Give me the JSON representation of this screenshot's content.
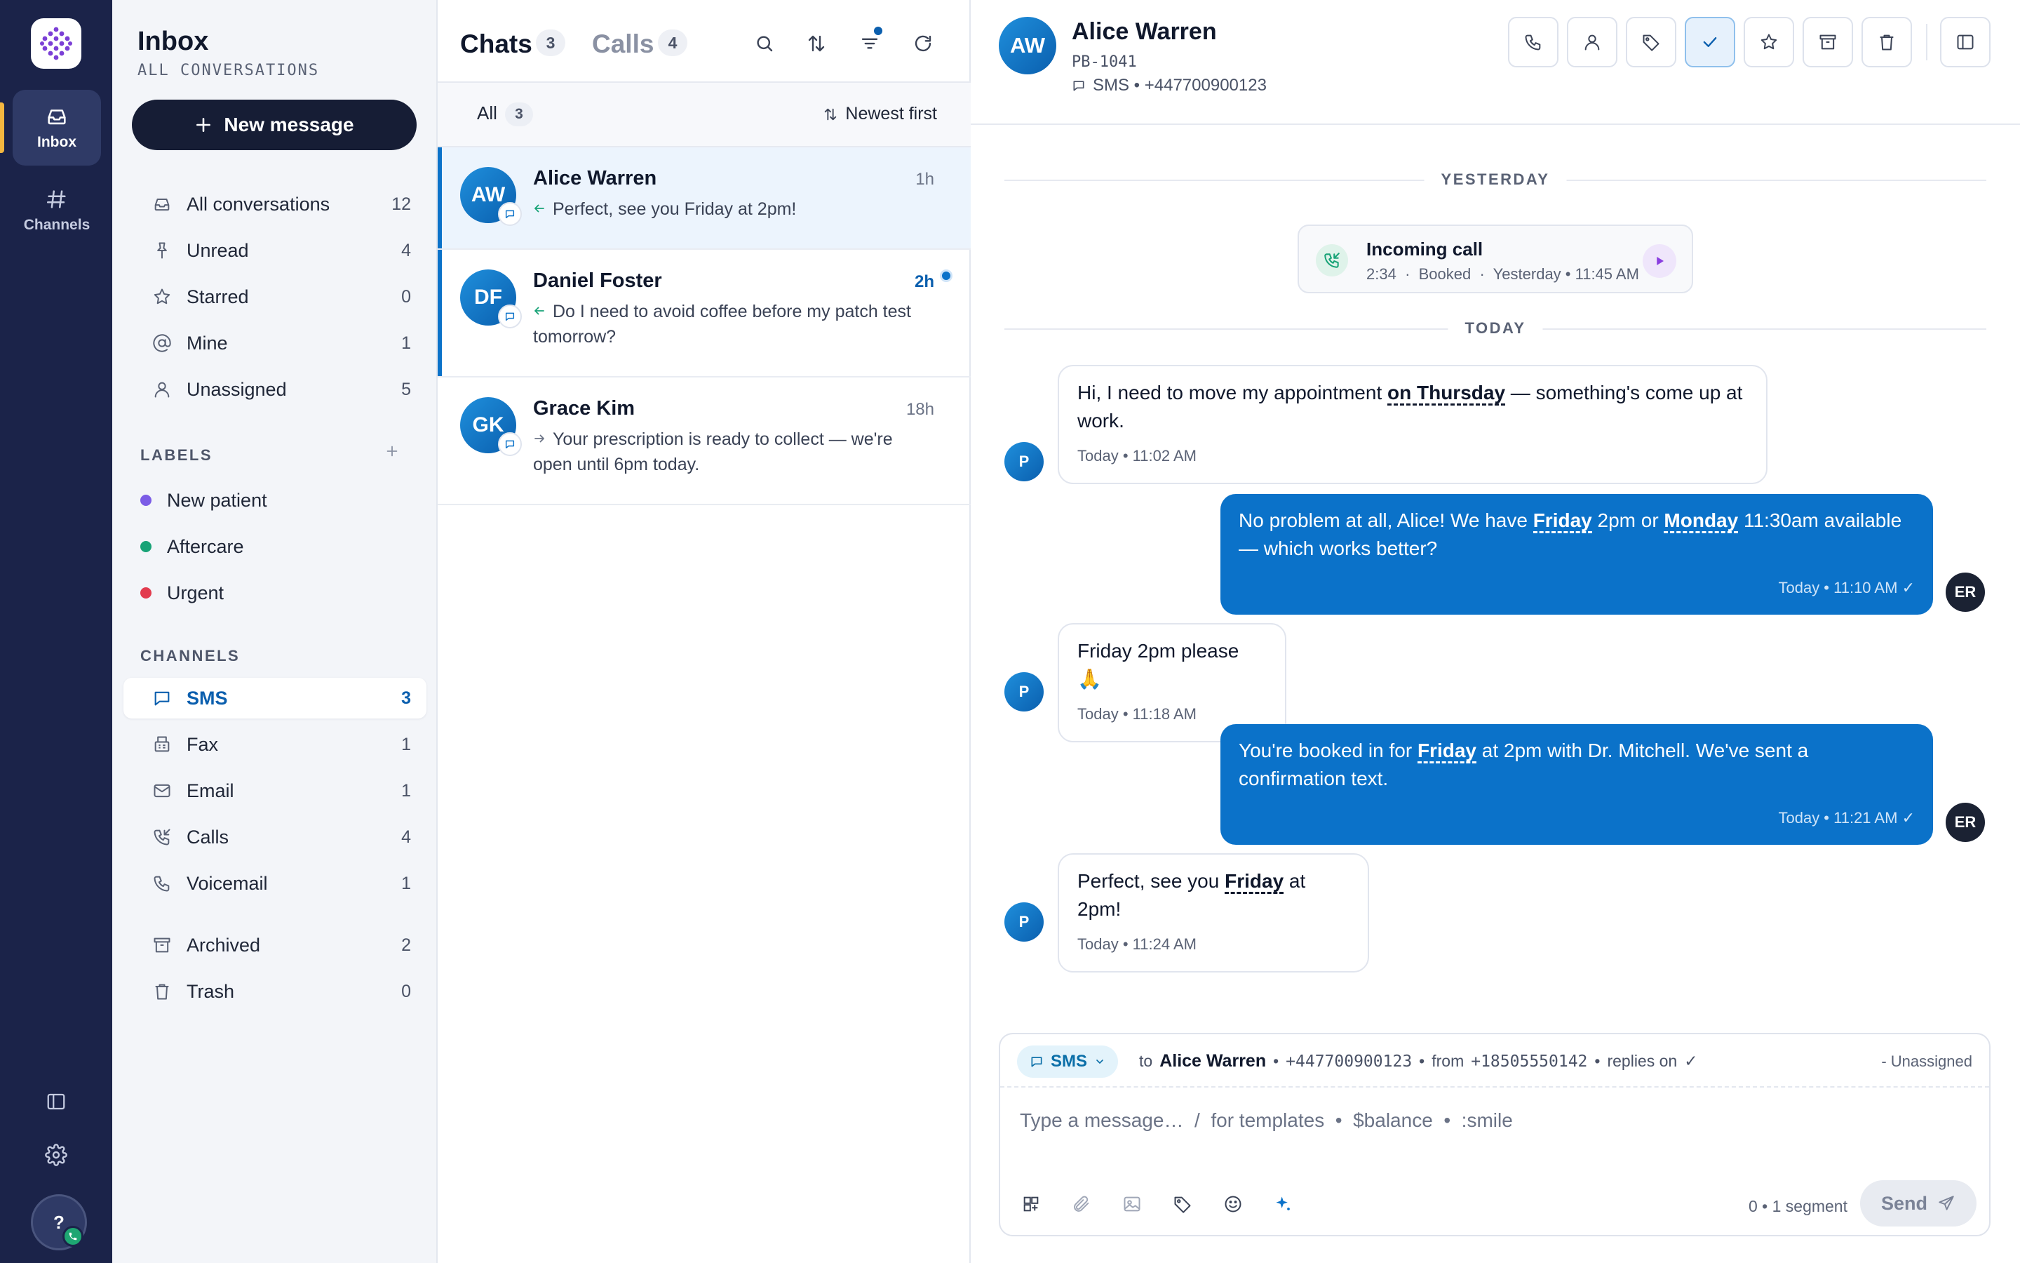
{
  "rail": {
    "items": [
      {
        "label": "Inbox",
        "icon": "inbox-icon"
      },
      {
        "label": "Channels",
        "icon": "hash-icon"
      }
    ],
    "help_label": "?",
    "accent": "#f4b740"
  },
  "sidebar": {
    "title": "Inbox",
    "subtitle": "ALL CONVERSATIONS",
    "new_message_label": "New message",
    "views": [
      {
        "label": "All conversations",
        "count": "12",
        "icon": "inbox-icon"
      },
      {
        "label": "Unread",
        "count": "4",
        "icon": "pin-icon"
      },
      {
        "label": "Starred",
        "count": "0",
        "icon": "star-icon"
      },
      {
        "label": "Mine",
        "count": "1",
        "icon": "at-icon"
      },
      {
        "label": "Unassigned",
        "count": "5",
        "icon": "user-icon"
      }
    ],
    "labels_heading": "LABELS",
    "labels": [
      {
        "label": "New patient",
        "color": "#7b5ce6"
      },
      {
        "label": "Aftercare",
        "color": "#18a377"
      },
      {
        "label": "Urgent",
        "color": "#e23b4e"
      }
    ],
    "channels_heading": "CHANNELS",
    "channels": [
      {
        "label": "SMS",
        "count": "3",
        "icon": "message-icon"
      },
      {
        "label": "Fax",
        "count": "1",
        "icon": "fax-icon"
      },
      {
        "label": "Email",
        "count": "1",
        "icon": "mail-icon"
      },
      {
        "label": "Calls",
        "count": "4",
        "icon": "phone-incoming-icon"
      },
      {
        "label": "Voicemail",
        "count": "1",
        "icon": "phone-icon"
      }
    ],
    "other": [
      {
        "label": "Archived",
        "count": "2",
        "icon": "archive-icon"
      },
      {
        "label": "Trash",
        "count": "0",
        "icon": "trash-icon"
      }
    ]
  },
  "list": {
    "tab_chats": "Chats",
    "tab_chats_count": "3",
    "tab_calls": "Calls",
    "tab_calls_count": "4",
    "filter_all": "All",
    "filter_all_count": "3",
    "sort_label": "Newest first",
    "conversations": [
      {
        "initials": "AW",
        "name": "Alice Warren",
        "time": "1h",
        "preview": "Perfect, see you Friday at 2pm!"
      },
      {
        "initials": "DF",
        "name": "Daniel Foster",
        "time": "2h",
        "preview": "Do I need to avoid coffee before my patch test tomorrow?"
      },
      {
        "initials": "GK",
        "name": "Grace Kim",
        "time": "18h",
        "preview": "Your prescription is ready to collect — we're open until 6pm today."
      }
    ]
  },
  "thread": {
    "initials": "AW",
    "name": "Alice Warren",
    "patient_id": "PB-1041",
    "channel": "SMS • +447700900123",
    "day_yesterday": "YESTERDAY",
    "day_today": "TODAY",
    "call": {
      "title": "Incoming call",
      "duration": "2:34",
      "outcome": "Booked",
      "when": "Yesterday • 11:45 AM"
    },
    "messages": [
      {
        "before": "Hi, I need to move my appointment ",
        "hl": "on Thursday",
        "after": " — something's come up at work.",
        "meta": "Today • 11:02 AM",
        "avatar": "P"
      },
      {
        "before": "No problem at all, Alice! We have ",
        "hl": "Friday",
        "mid": " 2pm or ",
        "hl2": "Monday",
        "after": " 11:30am available — which works better?",
        "meta": "Today • 11:10 AM",
        "avatar": "ER"
      },
      {
        "text": "Friday 2pm please 🙏",
        "meta": "Today • 11:18 AM",
        "avatar": "P"
      },
      {
        "before": "You're booked in for ",
        "hl": "Friday",
        "after": " at 2pm with Dr. Mitchell. We've sent a confirmation text.",
        "meta": "Today • 11:21 AM",
        "avatar": "ER"
      },
      {
        "before": "Perfect, see you ",
        "hl": "Friday",
        "after": " at 2pm!",
        "meta": "Today • 11:24 AM",
        "avatar": "P"
      }
    ]
  },
  "composer": {
    "channel": "SMS",
    "to_label": "to",
    "to_name": "Alice Warren",
    "to_number": "+447700900123",
    "from_label": "from",
    "from_number": "+18505550142",
    "replies_label": "replies on",
    "assignee": "- Unassigned",
    "placeholder": "Type a message…  /  for templates  •  $balance  •  :smile",
    "segment_info": "0 • 1 segment",
    "send_label": "Send"
  },
  "colors": {
    "rail_bg": "#1b2349",
    "primary": "#0b72c9",
    "outgoing_bubble": "#0b72c9"
  }
}
